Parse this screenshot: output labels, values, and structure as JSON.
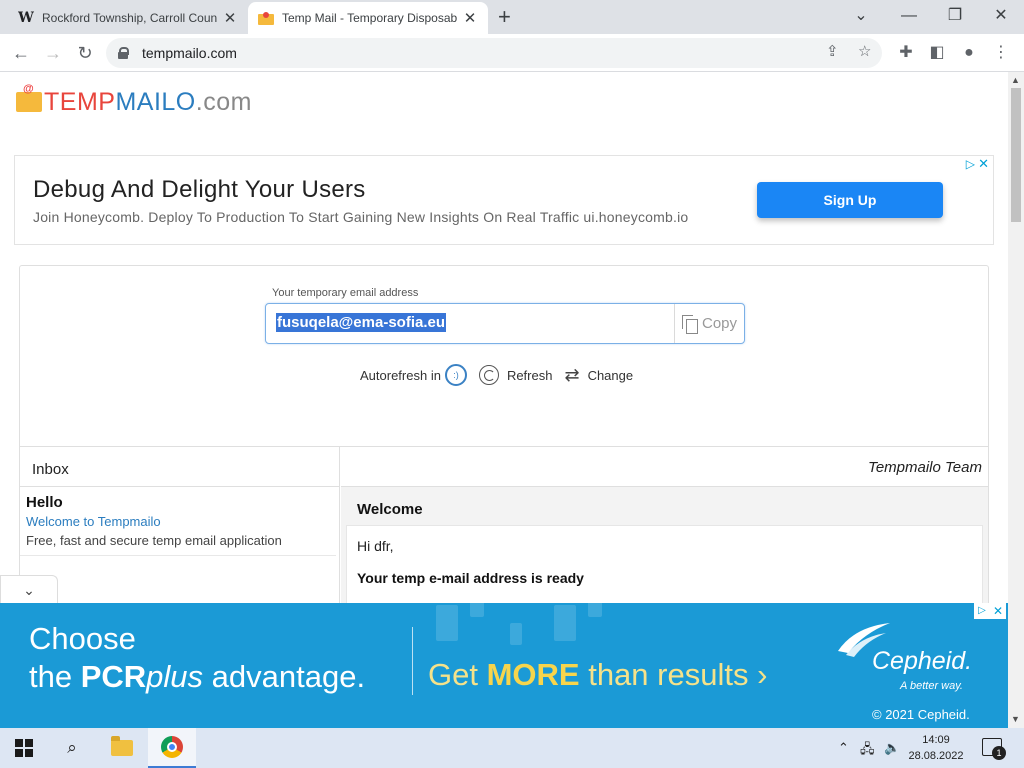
{
  "browser": {
    "tabs": [
      {
        "title": "Rockford Township, Carroll Coun",
        "favicon": "wikipedia-icon",
        "active": false
      },
      {
        "title": "Temp Mail - Temporary Disposab",
        "favicon": "tempmailo-icon",
        "active": true
      }
    ],
    "new_tab": "+",
    "window_controls": {
      "minimize": "—",
      "restore": "❐",
      "close": "✕",
      "tab_list": "⌄"
    },
    "url": "tempmailo.com"
  },
  "site": {
    "logo": {
      "part1": "TEMP",
      "part2": "MAILO",
      "part3": ".com"
    }
  },
  "ad_top": {
    "headline": "Debug And Delight Your Users",
    "subline": "Join Honeycomb. Deploy To Production To Start Gaining New Insights On Real Traffic ui.honeycomb.io",
    "button": "Sign Up"
  },
  "mailbox": {
    "label": "Your temporary email address",
    "email": "fusuqela@ema-sofia.eu",
    "copy": "Copy",
    "autorefresh": "Autorefresh in",
    "spinner": ":)",
    "refresh": "Refresh",
    "change": "Change"
  },
  "inbox": {
    "title": "Inbox",
    "items": [
      {
        "from": "Hello",
        "subject": "Welcome to Tempmailo",
        "preview": "Free, fast and secure temp email application"
      }
    ]
  },
  "message": {
    "sender": "Tempmailo Team",
    "subject": "Welcome",
    "greeting": "Hi dfr,",
    "heading": "Your temp e-mail address is ready"
  },
  "ad_bottom": {
    "line1": "Choose",
    "line2_a": "the ",
    "line2_b": "PCR",
    "line2_c": "plus",
    "line2_d": " advantage.",
    "cta_a": "Get ",
    "cta_b": "MORE",
    "cta_c": " than results ›",
    "brand": "Cepheid.",
    "tagline": "A better way.",
    "copyright": "© 2021 Cepheid."
  },
  "taskbar": {
    "time": "14:09",
    "date": "28.08.2022",
    "notification_count": "1"
  }
}
